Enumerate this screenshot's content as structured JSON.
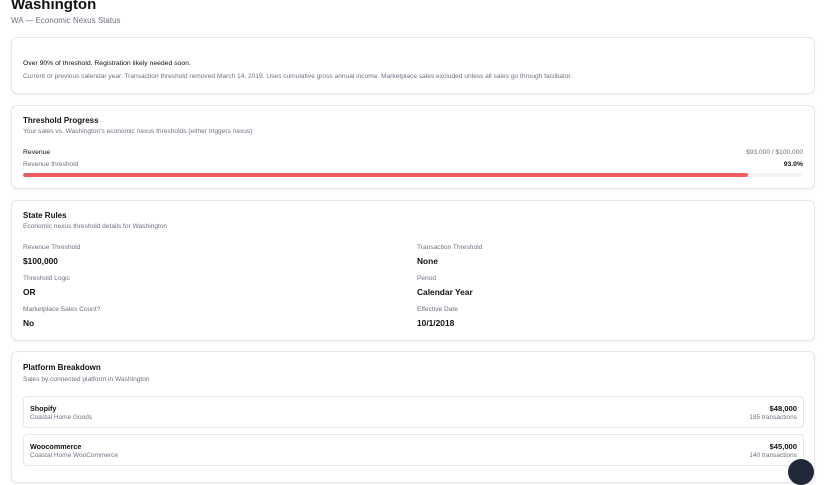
{
  "header": {
    "title": "Washington",
    "subtitle": "WA — Economic Nexus Status"
  },
  "alert": {
    "headline": "Over 90% of threshold. Registration likely needed soon.",
    "details": "Current or previous calendar year. Transaction threshold removed March 14, 2019. Uses cumulative gross annual income. Marketplace sales excluded unless all sales go through facilitator."
  },
  "threshold_progress": {
    "title": "Threshold Progress",
    "description": "Your sales vs. Washington's economic nexus thresholds (either triggers nexus)",
    "metric_label": "Revenue",
    "metric_value": "$93,000 / $100,000",
    "sub_label": "Revenue threshold",
    "percent_text": "93.0%",
    "progress_fraction": 0.93,
    "bar_color": "#ef5b62"
  },
  "state_rules": {
    "title": "State Rules",
    "description": "Economic nexus threshold details for Washington",
    "items": [
      {
        "label": "Revenue Threshold",
        "value": "$100,000"
      },
      {
        "label": "Transaction Threshold",
        "value": "None"
      },
      {
        "label": "Threshold Logic",
        "value": "OR"
      },
      {
        "label": "Period",
        "value": "Calendar Year"
      },
      {
        "label": "Marketplace Sales Count?",
        "value": "No"
      },
      {
        "label": "Effective Date",
        "value": "10/1/2018"
      }
    ]
  },
  "platform_breakdown": {
    "title": "Platform Breakdown",
    "description": "Sales by connected platform in Washington",
    "platforms": [
      {
        "name": "Shopify",
        "store": "Coastal Home Goods",
        "amount": "$48,000",
        "transactions": "185 transactions"
      },
      {
        "name": "Woocommerce",
        "store": "Coastal Home WooCommerce",
        "amount": "$45,000",
        "transactions": "140 transactions"
      }
    ]
  }
}
